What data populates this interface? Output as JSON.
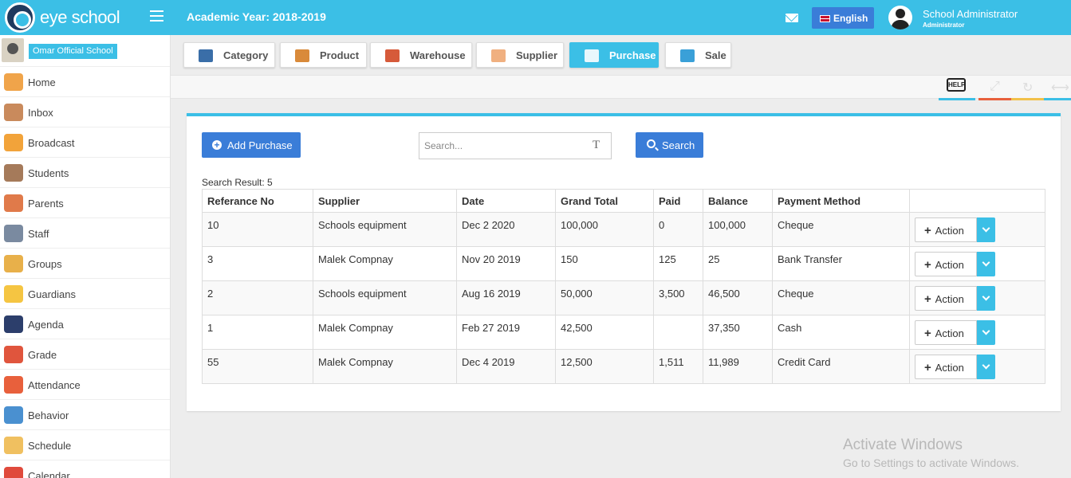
{
  "app": {
    "brand": "eye school",
    "academic_year": "Academic Year: 2018-2019"
  },
  "header": {
    "language": "English",
    "user_name": "School Administrator",
    "user_role": "Administrator"
  },
  "school": {
    "name": "Omar Official School"
  },
  "sidebar": {
    "items": [
      {
        "label": "Home",
        "icon": "home-icon",
        "color": "#f0a44a"
      },
      {
        "label": "Inbox",
        "icon": "inbox-icon",
        "color": "#c98a5c"
      },
      {
        "label": "Broadcast",
        "icon": "broadcast-icon",
        "color": "#f2a33a"
      },
      {
        "label": "Students",
        "icon": "students-icon",
        "color": "#a57a5a"
      },
      {
        "label": "Parents",
        "icon": "parents-icon",
        "color": "#e07a4a"
      },
      {
        "label": "Staff",
        "icon": "staff-icon",
        "color": "#7a8aa0"
      },
      {
        "label": "Groups",
        "icon": "groups-icon",
        "color": "#e8b04a"
      },
      {
        "label": "Guardians",
        "icon": "guardians-icon",
        "color": "#f5c542"
      },
      {
        "label": "Agenda",
        "icon": "agenda-icon",
        "color": "#2c3e6b"
      },
      {
        "label": "Grade",
        "icon": "grade-icon",
        "color": "#e0553d"
      },
      {
        "label": "Attendance",
        "icon": "attendance-icon",
        "color": "#e8603c"
      },
      {
        "label": "Behavior",
        "icon": "behavior-icon",
        "color": "#4a90d0"
      },
      {
        "label": "Schedule",
        "icon": "schedule-icon",
        "color": "#f0c060"
      },
      {
        "label": "Calendar",
        "icon": "calendar-icon",
        "color": "#e04a3c"
      }
    ]
  },
  "tabs": [
    {
      "label": "Category",
      "icon": "category-icon",
      "color": "#3a6ea8"
    },
    {
      "label": "Product",
      "icon": "product-icon",
      "color": "#d98a3a"
    },
    {
      "label": "Warehouse",
      "icon": "warehouse-icon",
      "color": "#d65a3a"
    },
    {
      "label": "Supplier",
      "icon": "supplier-icon",
      "color": "#f0b080"
    },
    {
      "label": "Purchase",
      "icon": "purchase-icon",
      "color": "#4a90d0"
    },
    {
      "label": "Sale",
      "icon": "sale-icon",
      "color": "#3aa0d8"
    }
  ],
  "tools": {
    "help": "HELP",
    "colors": [
      "#3bbfe6",
      "#e8603c",
      "#f2c14a",
      "#3bbfe6"
    ]
  },
  "main": {
    "add_button": "Add Purchase",
    "search_placeholder": "Search...",
    "search_button": "Search",
    "result_text": "Search Result: 5",
    "columns": [
      "Referance No",
      "Supplier",
      "Date",
      "Grand Total",
      "Paid",
      "Balance",
      "Payment Method",
      ""
    ],
    "rows": [
      {
        "ref": "10",
        "supplier": "Schools equipment",
        "date": "Dec 2 2020",
        "total": "100,000",
        "paid": "0",
        "balance": "100,000",
        "method": "Cheque"
      },
      {
        "ref": "3",
        "supplier": "Malek Compnay",
        "date": "Nov 20 2019",
        "total": "150",
        "paid": "125",
        "balance": "25",
        "method": "Bank Transfer"
      },
      {
        "ref": "2",
        "supplier": "Schools equipment",
        "date": "Aug 16 2019",
        "total": "50,000",
        "paid": "3,500",
        "balance": "46,500",
        "method": "Cheque"
      },
      {
        "ref": "1",
        "supplier": "Malek Compnay",
        "date": "Feb 27 2019",
        "total": "42,500",
        "paid": "",
        "balance": "37,350",
        "method": "Cash"
      },
      {
        "ref": "55",
        "supplier": "Malek Compnay",
        "date": "Dec 4 2019",
        "total": "12,500",
        "paid": "1,511",
        "balance": "11,989",
        "method": "Credit Card"
      }
    ],
    "action_label": "Action"
  },
  "watermark": {
    "line1": "Activate Windows",
    "line2": "Go to Settings to activate Windows."
  }
}
